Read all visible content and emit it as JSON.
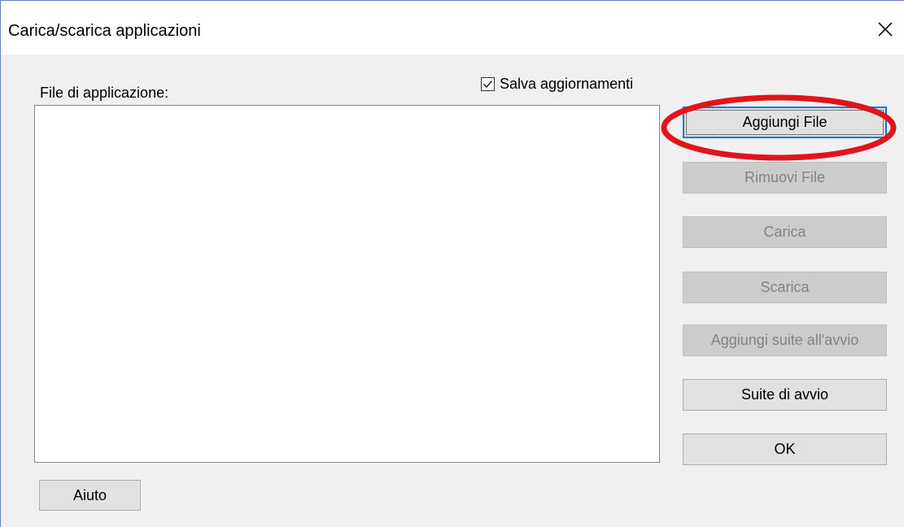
{
  "window": {
    "title": "Carica/scarica applicazioni",
    "close_glyph": "✕"
  },
  "main": {
    "files_label": "File di applicazione:",
    "save_updates": {
      "label": "Salva aggiornamenti",
      "checked": true
    },
    "file_list": []
  },
  "buttons": {
    "add_file": "Aggiungi File",
    "remove_file": "Rimuovi File",
    "upload": "Carica",
    "download": "Scarica",
    "add_startup_suite": "Aggiungi suite all'avvio",
    "startup_suite": "Suite di avvio",
    "ok": "OK",
    "help": "Aiuto"
  },
  "annotation": {
    "color": "#e2141b",
    "target": "add_file"
  },
  "colors": {
    "focus_border": "#0078d7",
    "disabled_text": "#838383"
  }
}
